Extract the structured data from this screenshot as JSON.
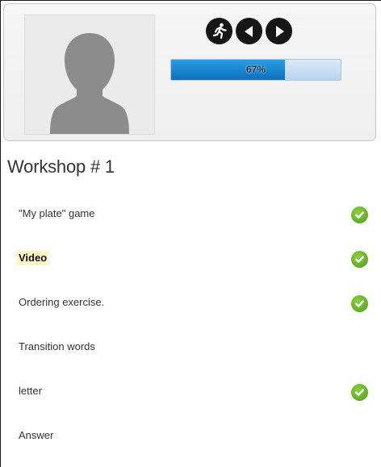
{
  "header": {
    "progress_percent": 67,
    "progress_text": "67%",
    "buttons": [
      {
        "icon": "running-person-icon"
      },
      {
        "icon": "previous-arrow-icon"
      },
      {
        "icon": "next-arrow-icon"
      }
    ],
    "avatar_icon": "person-silhouette-icon"
  },
  "workshop": {
    "title": "Workshop # 1",
    "items": [
      {
        "label": "\"My plate\" game",
        "completed": true,
        "active": false
      },
      {
        "label": "Video",
        "completed": true,
        "active": true
      },
      {
        "label": "Ordering exercise.",
        "completed": true,
        "active": false
      },
      {
        "label": "Transition words",
        "completed": false,
        "active": false
      },
      {
        "label": "letter",
        "completed": true,
        "active": false
      },
      {
        "label": "Answer",
        "completed": false,
        "active": false
      }
    ]
  },
  "colors": {
    "check_green": "#5aaa24",
    "progress_blue": "#1582d0",
    "active_highlight": "#fff6c4"
  }
}
